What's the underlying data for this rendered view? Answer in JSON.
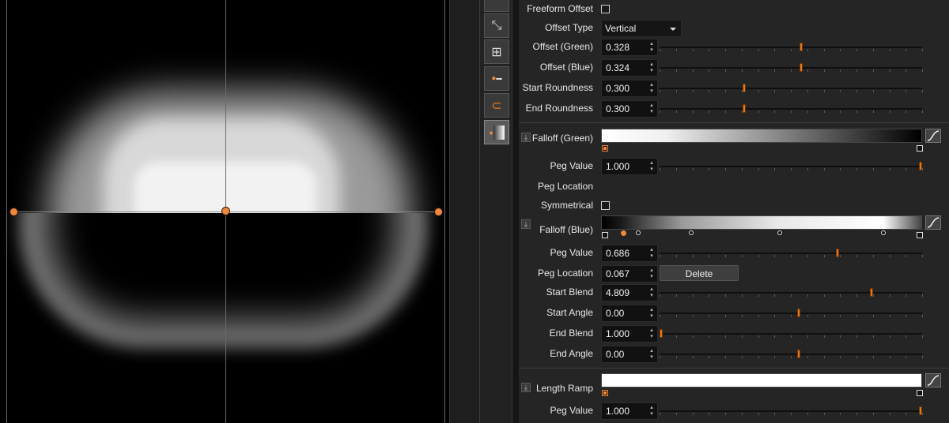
{
  "panel": {
    "freeform_offset": {
      "label": "Freeform Offset",
      "checked": false
    },
    "offset_type": {
      "label": "Offset Type",
      "value": "Vertical"
    },
    "offset_green": {
      "label": "Offset (Green)",
      "value": "0.328",
      "level": 0.54
    },
    "offset_blue": {
      "label": "Offset (Blue)",
      "value": "0.324",
      "level": 0.54
    },
    "start_roundness": {
      "label": "Start Roundness",
      "value": "0.300",
      "level": 0.32
    },
    "end_roundness": {
      "label": "End Roundness",
      "value": "0.300",
      "level": 0.32
    },
    "falloff_green": {
      "label": "Falloff (Green)",
      "peg_value": {
        "label": "Peg Value",
        "value": "1.000",
        "level": 1.0
      },
      "peg_location": {
        "label": "Peg Location"
      },
      "symmetrical": {
        "label": "Symmetrical",
        "checked": false
      }
    },
    "falloff_blue": {
      "label": "Falloff (Blue)",
      "peg_value": {
        "label": "Peg Value",
        "value": "0.686",
        "level": 0.68
      },
      "peg_location": {
        "label": "Peg Location",
        "value": "0.067"
      },
      "delete_label": "Delete",
      "start_blend": {
        "label": "Start Blend",
        "value": "4.809",
        "level": 0.81
      },
      "start_angle": {
        "label": "Start Angle",
        "value": "0.00",
        "level": 0.53
      },
      "end_blend": {
        "label": "End Blend",
        "value": "1.000",
        "level": 0.0
      },
      "end_angle": {
        "label": "End Angle",
        "value": "0.00",
        "level": 0.53
      },
      "pegs": [
        0.067,
        0.11,
        0.28,
        0.55,
        0.88
      ]
    },
    "length_ramp": {
      "label": "Length Ramp",
      "peg_value": {
        "label": "Peg Value",
        "value": "1.000",
        "level": 1.0
      }
    }
  },
  "colors": {
    "accent": "#f0883c",
    "panel_bg": "#252525",
    "viewport_bg": "#000000"
  },
  "toolbar": {
    "tools": [
      "shape-tool-icon",
      "squeeze-tool-icon",
      "expand-tool-icon",
      "grid-tool-icon",
      "line-point-tool-icon",
      "magnet-tool-icon",
      "falloff-tool-icon"
    ]
  }
}
